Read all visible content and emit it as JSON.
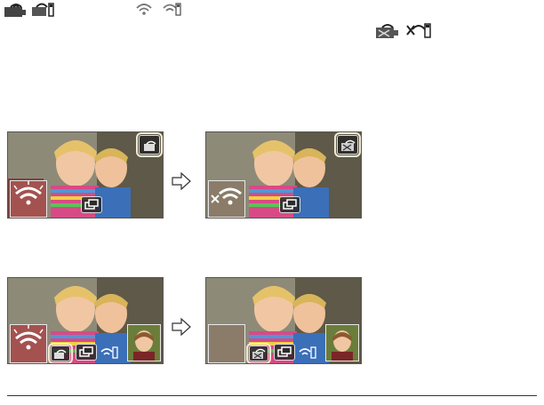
{
  "header_icons": [
    {
      "name": "camera-wifi-icon"
    },
    {
      "name": "camera-wifi-remote-icon"
    },
    {
      "name": "wifi-icon"
    },
    {
      "name": "wifi-remote-icon"
    },
    {
      "name": "camera-wifi-disconnected-icon"
    },
    {
      "name": "remote-disconnected-icon"
    }
  ],
  "colors": {
    "page_bg": "#ffffff",
    "frame_border": "#555555",
    "highlight": "#f1ead2",
    "badge_bg": "#2b2b2b",
    "divider": "#333333"
  },
  "screens": [
    {
      "name": "top-left-screen",
      "state": "connected",
      "has_sub_view": true,
      "sub_view_gray": false
    },
    {
      "name": "top-right-screen",
      "state": "disconnected",
      "has_sub_view": true,
      "sub_view_gray": true
    },
    {
      "name": "bottom-left-screen",
      "state": "multi-connected",
      "has_sub_view": true,
      "sub_view_gray": false
    },
    {
      "name": "bottom-right-screen",
      "state": "multi-disconnected",
      "has_sub_view": true,
      "sub_view_gray": true
    }
  ]
}
